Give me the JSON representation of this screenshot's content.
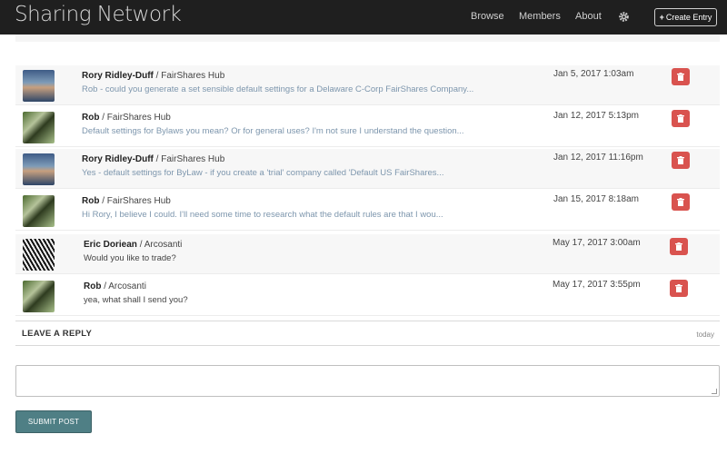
{
  "nav": {
    "brand": "Sharing Network",
    "links": [
      "Browse",
      "Members",
      "About"
    ],
    "create_label": "Create Entry",
    "gear_icon": "gear-icon"
  },
  "comments": [
    {
      "author": "Rory Ridley-Duff",
      "group": "FairShares Hub",
      "text": "Rob - could you generate a set sensible default settings for a Delaware C-Corp FairShares Company...",
      "date": "Jan 5, 2017 1:03am",
      "avatar": "rory"
    },
    {
      "author": "Rob",
      "group": "FairShares Hub",
      "text": "Default settings for Bylaws you mean? Or for general uses? I'm not sure I understand the question...",
      "date": "Jan 12, 2017 5:13pm",
      "avatar": "rob"
    },
    {
      "author": "Rory Ridley-Duff",
      "group": "FairShares Hub",
      "text": "Yes - default settings for ByLaw - if you create a 'trial' company called 'Default US FairShares...",
      "date": "Jan 12, 2017 11:16pm",
      "avatar": "rory"
    },
    {
      "author": "Rob",
      "group": "FairShares Hub",
      "text": "Hi Rory, I believe I could. I'll need some time to research what the default rules are that I wou...",
      "date": "Jan 15, 2017 8:18am",
      "avatar": "rob"
    },
    {
      "author": "Eric Doriean",
      "group": "Arcosanti",
      "text": "Would you like to trade?",
      "date": "May 17, 2017 3:00am",
      "avatar": "eric"
    },
    {
      "author": "Rob",
      "group": "Arcosanti",
      "text": "yea, what shall I send you?",
      "date": "May 17, 2017 3:55pm",
      "avatar": "rob"
    }
  ],
  "reply": {
    "title": "LEAVE A REPLY",
    "when": "today",
    "submit_label": "SUBMIT POST"
  },
  "colors": {
    "navbar": "#1f1f1f",
    "delete": "#d9534f",
    "submit": "#4f7f85",
    "link_text": "#7d96ad"
  }
}
